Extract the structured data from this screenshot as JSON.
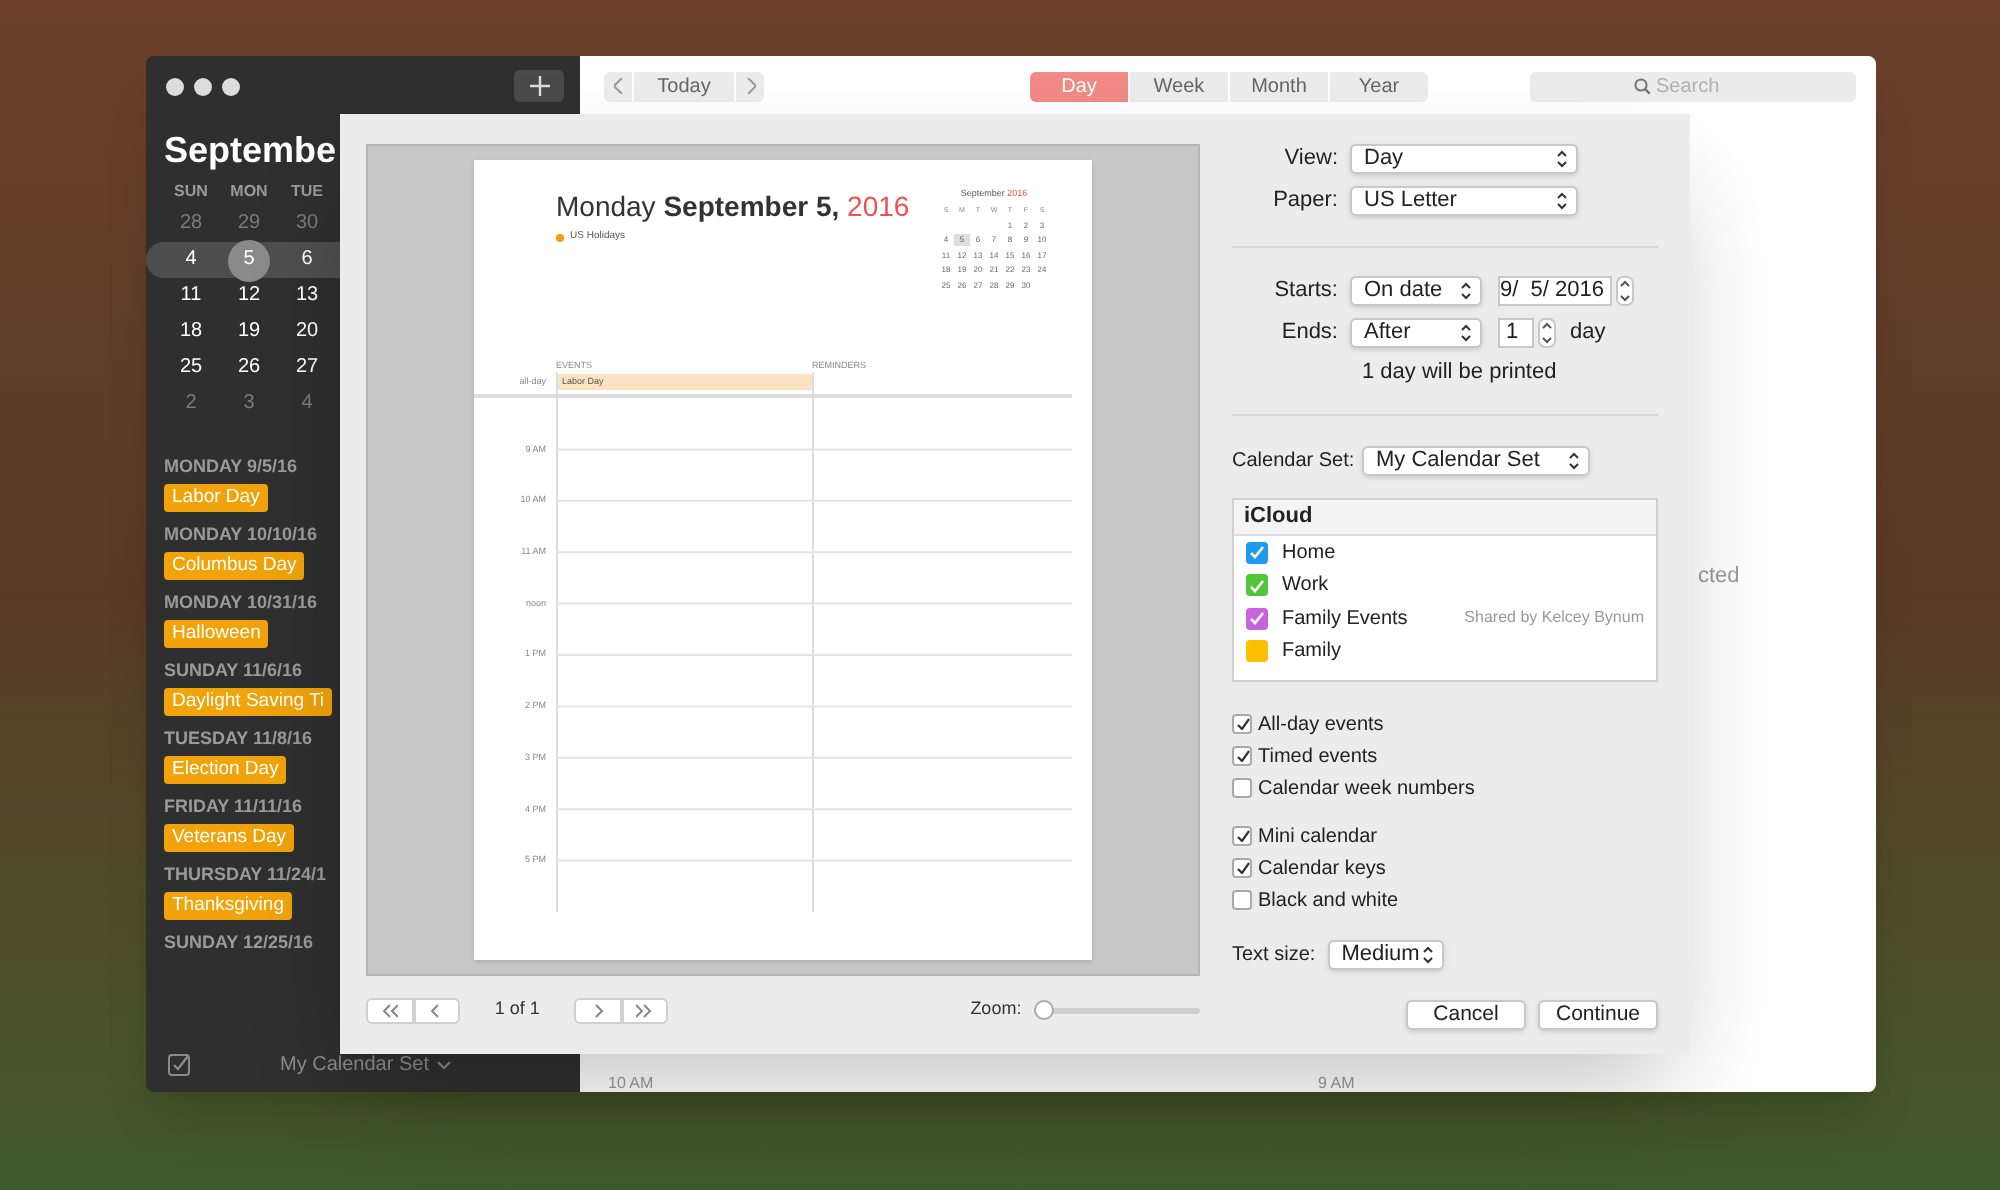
{
  "sidebar": {
    "month_title": "Septembe",
    "weekdays": [
      "SUN",
      "MON",
      "TUE"
    ],
    "weeks": [
      {
        "selected": false,
        "days": [
          {
            "label": "28",
            "other_month": true,
            "selected": false
          },
          {
            "label": "29",
            "other_month": true,
            "selected": false
          },
          {
            "label": "30",
            "other_month": true,
            "selected": false
          }
        ]
      },
      {
        "selected": true,
        "days": [
          {
            "label": "4",
            "other_month": false,
            "selected": false
          },
          {
            "label": "5",
            "other_month": false,
            "selected": true
          },
          {
            "label": "6",
            "other_month": false,
            "selected": false
          }
        ]
      },
      {
        "selected": false,
        "days": [
          {
            "label": "11",
            "other_month": false,
            "selected": false
          },
          {
            "label": "12",
            "other_month": false,
            "selected": false
          },
          {
            "label": "13",
            "other_month": false,
            "selected": false
          }
        ]
      },
      {
        "selected": false,
        "days": [
          {
            "label": "18",
            "other_month": false,
            "selected": false
          },
          {
            "label": "19",
            "other_month": false,
            "selected": false
          },
          {
            "label": "20",
            "other_month": false,
            "selected": false
          }
        ]
      },
      {
        "selected": false,
        "days": [
          {
            "label": "25",
            "other_month": false,
            "selected": false
          },
          {
            "label": "26",
            "other_month": false,
            "selected": false
          },
          {
            "label": "27",
            "other_month": false,
            "selected": false
          }
        ]
      },
      {
        "selected": false,
        "days": [
          {
            "label": "2",
            "other_month": true,
            "selected": false
          },
          {
            "label": "3",
            "other_month": true,
            "selected": false
          },
          {
            "label": "4",
            "other_month": true,
            "selected": false
          }
        ]
      }
    ],
    "agenda": [
      {
        "date": "MONDAY 9/5/16",
        "events": [
          "Labor Day"
        ]
      },
      {
        "date": "MONDAY 10/10/16",
        "events": [
          "Columbus Day"
        ]
      },
      {
        "date": "MONDAY 10/31/16",
        "events": [
          "Halloween"
        ]
      },
      {
        "date": "SUNDAY 11/6/16",
        "events": [
          "Daylight Saving Ti"
        ]
      },
      {
        "date": "TUESDAY 11/8/16",
        "events": [
          "Election Day"
        ]
      },
      {
        "date": "FRIDAY 11/11/16",
        "events": [
          "Veterans Day"
        ]
      },
      {
        "date": "THURSDAY 11/24/1",
        "events": [
          "Thanksgiving"
        ]
      },
      {
        "date": "SUNDAY 12/25/16"
      }
    ],
    "calendar_set": "My Calendar Set"
  },
  "toolbar": {
    "today": "Today",
    "views": [
      {
        "label": "Day",
        "selected": true
      },
      {
        "label": "Week",
        "selected": false
      },
      {
        "label": "Month",
        "selected": false
      },
      {
        "label": "Year",
        "selected": false
      }
    ],
    "search": {
      "placeholder": "Search"
    }
  },
  "main": {
    "detail_text": "cted",
    "hour_labels": [
      "10 AM",
      "9 AM"
    ]
  },
  "print_dialog": {
    "preview": {
      "title": "Monday **September 5,**",
      "year": "2016",
      "legend": [
        "US Holidays"
      ],
      "mini_calendar": {
        "month": "September",
        "year": "2016",
        "weekdays": [
          "S",
          "M",
          "T",
          "W",
          "T",
          "F",
          "S"
        ],
        "weeks": [
          [
            {
              "label": "1",
              "selected": false
            },
            {
              "label": "2",
              "selected": false
            },
            {
              "label": "3",
              "selected": false
            }
          ],
          [
            {
              "label": "4",
              "selected": false
            },
            {
              "label": "5",
              "selected": true
            },
            {
              "label": "6",
              "selected": false
            },
            {
              "label": "7",
              "selected": false
            },
            {
              "label": "8",
              "selected": false
            },
            {
              "label": "9",
              "selected": false
            },
            {
              "label": "10",
              "selected": false
            }
          ],
          [
            {
              "label": "11",
              "selected": false
            },
            {
              "label": "12",
              "selected": false
            },
            {
              "label": "13",
              "selected": false
            },
            {
              "label": "14",
              "selected": false
            },
            {
              "label": "15",
              "selected": false
            },
            {
              "label": "16",
              "selected": false
            },
            {
              "label": "17",
              "selected": false
            }
          ],
          [
            {
              "label": "18",
              "selected": false
            },
            {
              "label": "19",
              "selected": false
            },
            {
              "label": "20",
              "selected": false
            },
            {
              "label": "21",
              "selected": false
            },
            {
              "label": "22",
              "selected": false
            },
            {
              "label": "23",
              "selected": false
            },
            {
              "label": "24",
              "selected": false
            }
          ],
          [
            {
              "label": "25",
              "selected": false
            },
            {
              "label": "26",
              "selected": false
            },
            {
              "label": "27",
              "selected": false
            },
            {
              "label": "28",
              "selected": false
            },
            {
              "label": "29",
              "selected": false
            },
            {
              "label": "30",
              "selected": false
            }
          ]
        ]
      },
      "columns": [
        "EVENTS",
        "REMINDERS"
      ],
      "allday_label": "all-day",
      "allday_events": [
        "Labor Day"
      ],
      "hours": [
        "9 AM",
        "10 AM",
        "11 AM",
        "noon",
        "1 PM",
        "2 PM",
        "3 PM",
        "4 PM",
        "5 PM"
      ]
    },
    "pager": {
      "page": "1 of 1"
    },
    "zoom": {
      "label": "Zoom:",
      "level": 0
    },
    "view": {
      "label": "View:",
      "value": "Day"
    },
    "paper": {
      "label": "Paper:",
      "value": "US Letter"
    },
    "starts": {
      "label": "Starts:",
      "mode": "On date",
      "date": "9/  5/ 2016"
    },
    "ends": {
      "label": "Ends:",
      "mode": "After",
      "count": "1",
      "unit": "day"
    },
    "summary": "1 day will be printed",
    "calendar_set": {
      "label": "Calendar Set:",
      "value": "My Calendar Set"
    },
    "calendars": {
      "group": "iCloud",
      "items": [
        {
          "name": "Home",
          "checked": true,
          "color": "#1e9bf0"
        },
        {
          "name": "Work",
          "checked": true,
          "color": "#52c63b"
        },
        {
          "name": "Family Events",
          "checked": true,
          "color": "#c763de",
          "note": "Shared by Kelcey Bynum"
        },
        {
          "name": "Family",
          "checked": false,
          "color": "#fcc000"
        }
      ]
    },
    "option_groups": [
      [
        {
          "label": "All-day events",
          "checked": true
        },
        {
          "label": "Timed events",
          "checked": true
        },
        {
          "label": "Calendar week numbers",
          "checked": false
        }
      ],
      [
        {
          "label": "Mini calendar",
          "checked": true
        },
        {
          "label": "Calendar keys",
          "checked": true
        },
        {
          "label": "Black and white",
          "checked": false
        }
      ]
    ],
    "text_size": {
      "label": "Text size:",
      "value": "Medium"
    },
    "buttons": [
      "Cancel",
      "Continue"
    ]
  }
}
